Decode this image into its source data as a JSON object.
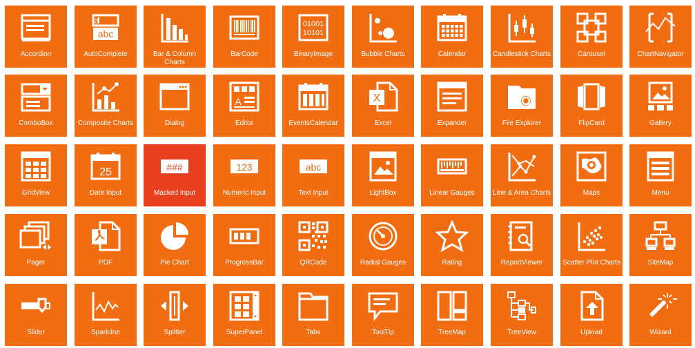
{
  "tiles": [
    {
      "label": "Accordion",
      "icon": "accordion-icon"
    },
    {
      "label": "AutoComplete",
      "icon": "autocomplete-icon"
    },
    {
      "label": "Bar & Column Charts",
      "icon": "bar-chart-icon"
    },
    {
      "label": "BarCode",
      "icon": "barcode-icon"
    },
    {
      "label": "BinaryImage",
      "icon": "binary-image-icon",
      "icon_text": "01001\n10101"
    },
    {
      "label": "Bubble Charts",
      "icon": "bubble-chart-icon"
    },
    {
      "label": "Calendar",
      "icon": "calendar-icon"
    },
    {
      "label": "Candlestick Charts",
      "icon": "candlestick-chart-icon"
    },
    {
      "label": "Carousel",
      "icon": "carousel-icon"
    },
    {
      "label": "ChartNavigator",
      "icon": "chart-navigator-icon"
    },
    {
      "label": "ComboBox",
      "icon": "combobox-icon"
    },
    {
      "label": "Composite Charts",
      "icon": "composite-chart-icon"
    },
    {
      "label": "Dialog",
      "icon": "dialog-icon"
    },
    {
      "label": "Editor",
      "icon": "editor-icon"
    },
    {
      "label": "EventsCalendar",
      "icon": "events-calendar-icon"
    },
    {
      "label": "Excel",
      "icon": "excel-icon"
    },
    {
      "label": "Expander",
      "icon": "expander-icon"
    },
    {
      "label": "File Explorer",
      "icon": "file-explorer-icon"
    },
    {
      "label": "FlipCard",
      "icon": "flipcard-icon"
    },
    {
      "label": "Gallery",
      "icon": "gallery-icon"
    },
    {
      "label": "GridView",
      "icon": "gridview-icon"
    },
    {
      "label": "Date Input",
      "icon": "date-input-icon",
      "icon_text": "25"
    },
    {
      "label": "Masked Input",
      "icon": "masked-input-icon",
      "icon_text": "###",
      "active": true
    },
    {
      "label": "Numeric Input",
      "icon": "numeric-input-icon",
      "icon_text": "123"
    },
    {
      "label": "Text Input",
      "icon": "text-input-icon",
      "icon_text": "abc"
    },
    {
      "label": "LightBox",
      "icon": "lightbox-icon"
    },
    {
      "label": "Linear Gauges",
      "icon": "linear-gauge-icon"
    },
    {
      "label": "Line & Area Charts",
      "icon": "line-chart-icon"
    },
    {
      "label": "Maps",
      "icon": "map-icon"
    },
    {
      "label": "Menu",
      "icon": "menu-icon"
    },
    {
      "label": "Pager",
      "icon": "pager-icon"
    },
    {
      "label": "PDF",
      "icon": "pdf-icon"
    },
    {
      "label": "Pie Chart",
      "icon": "pie-chart-icon"
    },
    {
      "label": "ProgressBar",
      "icon": "progress-bar-icon"
    },
    {
      "label": "QRCode",
      "icon": "qrcode-icon"
    },
    {
      "label": "Radial Gauges",
      "icon": "radial-gauge-icon"
    },
    {
      "label": "Rating",
      "icon": "star-icon"
    },
    {
      "label": "ReportViewer",
      "icon": "report-viewer-icon"
    },
    {
      "label": "Scatter Plot Charts",
      "icon": "scatter-chart-icon"
    },
    {
      "label": "SiteMap",
      "icon": "sitemap-icon"
    },
    {
      "label": "Slider",
      "icon": "slider-icon"
    },
    {
      "label": "Sparkline",
      "icon": "sparkline-icon"
    },
    {
      "label": "Splitter",
      "icon": "splitter-icon"
    },
    {
      "label": "SuperPanel",
      "icon": "superpanel-icon"
    },
    {
      "label": "Tabs",
      "icon": "tabs-icon"
    },
    {
      "label": "ToolTip",
      "icon": "tooltip-icon"
    },
    {
      "label": "TreeMap",
      "icon": "treemap-icon"
    },
    {
      "label": "TreeView",
      "icon": "treeview-icon"
    },
    {
      "label": "Upload",
      "icon": "upload-icon"
    },
    {
      "label": "Wizard",
      "icon": "wizard-icon"
    }
  ],
  "colors": {
    "tile": "#f26c12",
    "active_tile": "#e8401c",
    "icon": "#ffffff"
  }
}
